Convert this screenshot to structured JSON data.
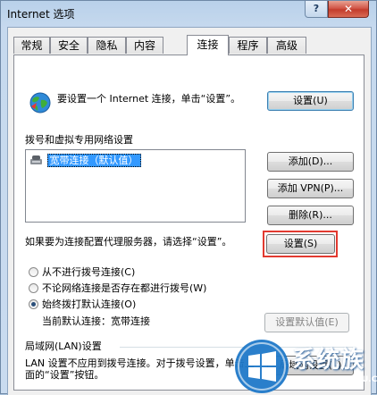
{
  "window": {
    "title": "Internet 选项",
    "help": "?",
    "close": "✕"
  },
  "tabs": [
    "常规",
    "安全",
    "隐私",
    "内容",
    "连接",
    "程序",
    "高级"
  ],
  "active_tab": "连接",
  "setup": {
    "text": "要设置一个 Internet 连接，单击“设置”。",
    "button": "设置(U)"
  },
  "dialup": {
    "heading": "拨号和虚拟专用网络设置",
    "items": [
      "宽带连接（默认值）"
    ],
    "add": "添加(D)...",
    "add_vpn": "添加 VPN(P)...",
    "remove": "删除(R)...",
    "proxy_text": "如果要为连接配置代理服务器，请选择“设置”。",
    "settings": "设置(S)",
    "radio_never": "从不进行拨号连接(C)",
    "radio_whenever": "不论网络连接是否存在都进行拨号(W)",
    "radio_always": "始终拨打默认连接(O)",
    "current_default": "当前默认连接：宽带连接",
    "set_default": "设置默认值(E)"
  },
  "lan": {
    "heading": "局域网(LAN)设置",
    "text": "LAN 设置不应用到拨号连接。对于拨号设置，单击上面的“设置”按钮。",
    "button": "局域网设置(L)"
  },
  "watermark": {
    "brand": "系统族",
    "url": "WWW.XITONGZU.COM"
  }
}
